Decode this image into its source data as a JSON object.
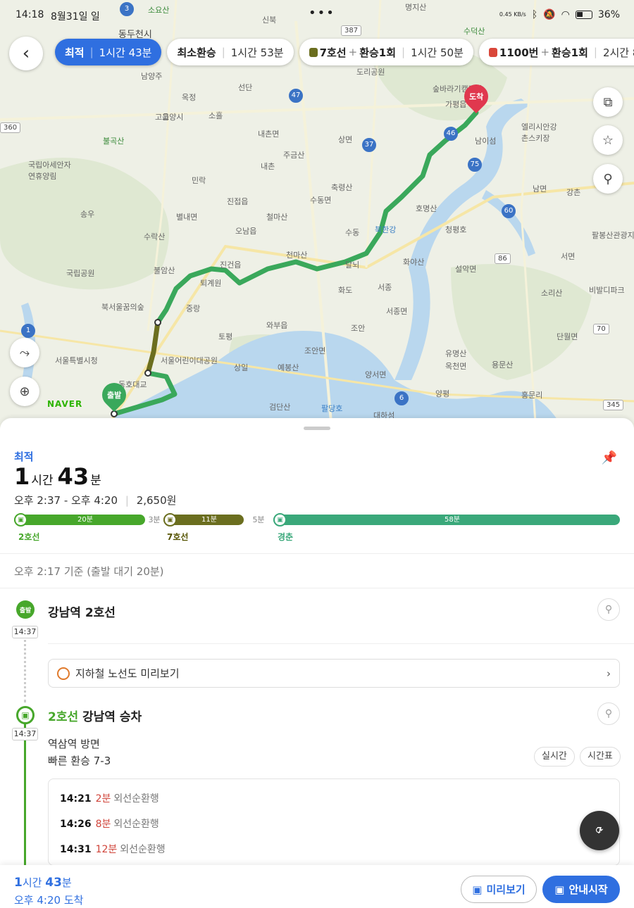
{
  "status_bar": {
    "time": "14:18",
    "date": "8월31일 일",
    "battery": "36%",
    "network_speed": "0.45 KB/s"
  },
  "route_tabs": [
    {
      "main": "최적",
      "time": "1시간 43분",
      "active": true
    },
    {
      "main": "최소환승",
      "time": "1시간 53분",
      "active": false
    },
    {
      "main": "7호선",
      "plus": "+",
      "transfer": "환승1회",
      "time": "1시간 50분",
      "icon": "subway-icon",
      "color": "#6b6e1f"
    },
    {
      "main": "1100번",
      "plus": "+",
      "transfer": "환승1회",
      "time": "2시간 8분",
      "icon": "bus-icon",
      "color": "#d9473a"
    }
  ],
  "map": {
    "origin_label": "출발",
    "destination_label": "도착",
    "logo": "NAVER",
    "places": [
      "동두천시",
      "소요산",
      "명지산",
      "수덕산",
      "고양시",
      "남양주",
      "가평읍",
      "남이섬",
      "북한강",
      "청평호",
      "호명산",
      "축령산",
      "천마산",
      "수락산",
      "불암산",
      "퇴계원",
      "화도",
      "진접읍",
      "양평",
      "서울어린이대공원",
      "동호대교",
      "검단산",
      "팔당호",
      "대하섬",
      "예봉산",
      "용문산",
      "유명산",
      "상면",
      "설악면",
      "소리산",
      "비발디파크",
      "엘리시안강촌스키장",
      "팔봉산관광지",
      "국립아세안자연휴양림",
      "북서울꿈의숲",
      "서울특별시청",
      "국립공원",
      "불곡산",
      "도리공원",
      "숲바라기캠핑장",
      "주금산",
      "철마산",
      "화야산",
      "조안면",
      "옥천면",
      "서종면",
      "서종",
      "조안",
      "토평",
      "중랑",
      "상일",
      "와부읍",
      "양서면",
      "홍문리",
      "강촌",
      "남면",
      "서면",
      "단월면",
      "신북",
      "선단",
      "옥정",
      "송우",
      "민락",
      "수동",
      "달뇌",
      "고읍",
      "소흘",
      "내촌",
      "내촌면",
      "진건읍",
      "오남읍",
      "수동면",
      "별내면"
    ],
    "road_numbers": [
      "387",
      "47",
      "37",
      "46",
      "75",
      "60",
      "86",
      "70",
      "345",
      "360",
      "1",
      "6",
      "3"
    ]
  },
  "summary": {
    "label": "최적",
    "hours": "1",
    "hours_unit": "시간",
    "minutes": "43",
    "minutes_unit": "분",
    "time_range": "오후 2:37 - 오후 4:20",
    "fare": "2,650원"
  },
  "segments": [
    {
      "name": "2호선",
      "minutes": "20분",
      "color": "#47a72b",
      "type": "ride"
    },
    {
      "minutes": "3분",
      "type": "walk"
    },
    {
      "name": "7호선",
      "minutes": "11분",
      "color": "#6b6e1f",
      "type": "ride"
    },
    {
      "minutes": "5분",
      "type": "walk"
    },
    {
      "name": "경춘",
      "minutes": "58분",
      "color": "#3aa87a",
      "type": "ride"
    }
  ],
  "basis_text": "오후 2:17 기준 (출발 대기 20분)",
  "steps": {
    "origin": {
      "badge": "출발",
      "time": "14:37",
      "title": "강남역 2호선"
    },
    "preview_link": "지하철 노선도 미리보기",
    "boarding": {
      "time": "14:37",
      "line": "2호선",
      "title": "강남역 승차",
      "direction": "역삼역 방면",
      "fast_transfer": "빠른 환승 7-3",
      "realtime_btn": "실시간",
      "timetable_btn": "시간표"
    },
    "schedule": [
      {
        "time": "14:21",
        "wait": "2분",
        "dest": "외선순환행"
      },
      {
        "time": "14:26",
        "wait": "8분",
        "dest": "외선순환행"
      },
      {
        "time": "14:31",
        "wait": "12분",
        "dest": "외선순환행"
      }
    ],
    "refresh_count": "7"
  },
  "bottom_bar": {
    "hours": "1",
    "hours_unit": "시간",
    "minutes": "43",
    "minutes_unit": "분",
    "arrival": "오후 4:20 도착",
    "preview_btn": "미리보기",
    "start_btn": "안내시작"
  },
  "colors": {
    "accent": "#2f6fe0",
    "line2": "#47a72b",
    "line7": "#6b6e1f",
    "gyeongchun": "#3aa87a",
    "destination": "#e0384e"
  }
}
